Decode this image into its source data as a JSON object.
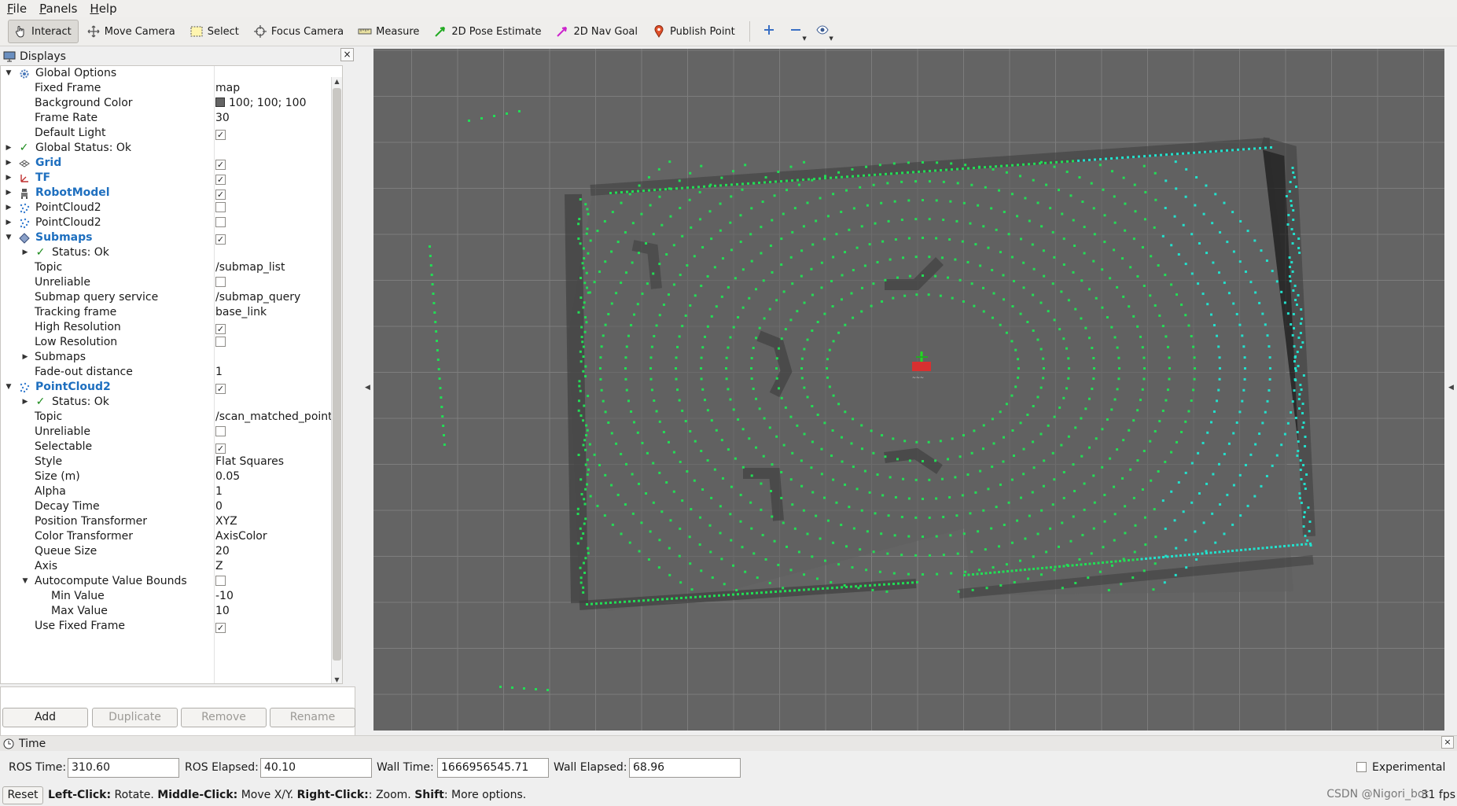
{
  "menu": [
    "File",
    "Panels",
    "Help"
  ],
  "menu_mnemonic": [
    "F",
    "P",
    "H"
  ],
  "menu_rest": [
    "ile",
    "anels",
    "elp"
  ],
  "toolbar": {
    "interact": "Interact",
    "move_camera": "Move Camera",
    "select": "Select",
    "focus_camera": "Focus Camera",
    "measure": "Measure",
    "pose_estimate": "2D Pose Estimate",
    "nav_goal": "2D Nav Goal",
    "publish_point": "Publish Point"
  },
  "displays": {
    "title": "Displays",
    "rows": [
      {
        "name": "Global Options",
        "value": ""
      },
      {
        "name": "Fixed Frame",
        "value": "map"
      },
      {
        "name": "Background Color",
        "value": "100; 100; 100"
      },
      {
        "name": "Frame Rate",
        "value": "30"
      },
      {
        "name": "Default Light",
        "value": ""
      },
      {
        "name": "Global Status: Ok",
        "value": ""
      },
      {
        "name": "Grid",
        "value": ""
      },
      {
        "name": "TF",
        "value": ""
      },
      {
        "name": "RobotModel",
        "value": ""
      },
      {
        "name": "PointCloud2",
        "value": ""
      },
      {
        "name": "PointCloud2",
        "value": ""
      },
      {
        "name": "Submaps",
        "value": ""
      },
      {
        "name": "Status: Ok",
        "value": ""
      },
      {
        "name": "Topic",
        "value": "/submap_list"
      },
      {
        "name": "Unreliable",
        "value": ""
      },
      {
        "name": "Submap query service",
        "value": "/submap_query"
      },
      {
        "name": "Tracking frame",
        "value": "base_link"
      },
      {
        "name": "High Resolution",
        "value": ""
      },
      {
        "name": "Low Resolution",
        "value": ""
      },
      {
        "name": "Submaps",
        "value": ""
      },
      {
        "name": "Fade-out distance",
        "value": "1"
      },
      {
        "name": "PointCloud2",
        "value": ""
      },
      {
        "name": "Status: Ok",
        "value": ""
      },
      {
        "name": "Topic",
        "value": "/scan_matched_point..."
      },
      {
        "name": "Unreliable",
        "value": ""
      },
      {
        "name": "Selectable",
        "value": ""
      },
      {
        "name": "Style",
        "value": "Flat Squares"
      },
      {
        "name": "Size (m)",
        "value": "0.05"
      },
      {
        "name": "Alpha",
        "value": "1"
      },
      {
        "name": "Decay Time",
        "value": "0"
      },
      {
        "name": "Position Transformer",
        "value": "XYZ"
      },
      {
        "name": "Color Transformer",
        "value": "AxisColor"
      },
      {
        "name": "Queue Size",
        "value": "20"
      },
      {
        "name": "Axis",
        "value": "Z"
      },
      {
        "name": "Autocompute Value Bounds",
        "value": ""
      },
      {
        "name": "Min Value",
        "value": "-10"
      },
      {
        "name": "Max Value",
        "value": "10"
      },
      {
        "name": "Use Fixed Frame",
        "value": ""
      }
    ],
    "checkbox_states": {
      "default_light": true,
      "grid": true,
      "tf": true,
      "robot_model": true,
      "pointcloud2_a": false,
      "pointcloud2_b": false,
      "submaps": true,
      "submaps_unreliable": false,
      "high_resolution": true,
      "low_resolution": false,
      "pointcloud2_c": true,
      "pc_unreliable": false,
      "selectable": true,
      "autocompute": false,
      "use_fixed_frame": true
    }
  },
  "buttons": {
    "add": "Add",
    "duplicate": "Duplicate",
    "remove": "Remove",
    "rename": "Rename"
  },
  "time": {
    "title": "Time",
    "ros_time_label": "ROS Time:",
    "ros_time": "310.60",
    "ros_elapsed_label": "ROS Elapsed:",
    "ros_elapsed": "40.10",
    "wall_time_label": "Wall Time:",
    "wall_time": "1666956545.71",
    "wall_elapsed_label": "Wall Elapsed:",
    "wall_elapsed": "68.96",
    "experimental": "Experimental"
  },
  "status": {
    "reset": "Reset",
    "left_click": "Left-Click:",
    "left_action": " Rotate. ",
    "middle_click": "Middle-Click:",
    "middle_action": " Move X/Y. ",
    "right_click": "Right-Click:",
    "right_action": ": Zoom. ",
    "shift": "Shift",
    "shift_action": ": More options.",
    "fps": "31 fps"
  },
  "watermark": "CSDN @Nigori_bot",
  "colors": {
    "view_bg": "#646464",
    "grid": "#7d7d7d",
    "points_green": "#22dd55",
    "points_cyan": "#22e0cc",
    "link_blue": "#1e6fbf"
  }
}
